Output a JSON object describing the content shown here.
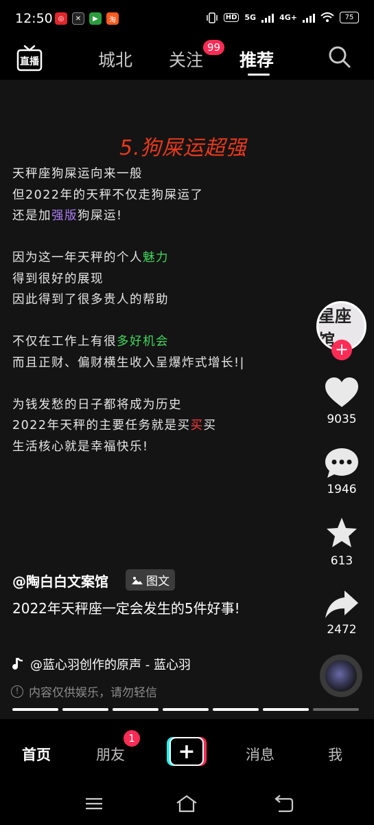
{
  "status_bar": {
    "time": "12:50",
    "network": "5G",
    "network2": "4G+",
    "battery": "75",
    "hd_label": "HD"
  },
  "top_nav": {
    "tabs": [
      {
        "label": "城北",
        "active": false
      },
      {
        "label": "关注",
        "active": false
      },
      {
        "label": "推荐",
        "active": true
      }
    ],
    "follow_badge": "99",
    "live_label": "直播"
  },
  "post": {
    "headline": "5.狗屎运超强",
    "lines": [
      [
        {
          "t": "天秤座狗屎运向来一般"
        }
      ],
      [
        {
          "t": "但2022年的天秤不仅走狗屎运了"
        }
      ],
      [
        {
          "t": "还是加"
        },
        {
          "t": "强版",
          "c": "purple"
        },
        {
          "t": "狗屎运!"
        }
      ],
      [],
      [
        {
          "t": "因为这一年天秤的个人"
        },
        {
          "t": "魅力",
          "c": "green"
        }
      ],
      [
        {
          "t": "得到很好的展现"
        }
      ],
      [
        {
          "t": "因此得到了很多贵人的帮助"
        }
      ],
      [],
      [
        {
          "t": "不仅在工作上有很"
        },
        {
          "t": "多好机会",
          "c": "green"
        }
      ],
      [
        {
          "t": "而且正财、偏财横生收入呈爆炸式增长!|"
        }
      ],
      [],
      [
        {
          "t": "为钱发愁的日子都将成为历史"
        }
      ],
      [
        {
          "t": "2022年天秤的主要任务就是买"
        },
        {
          "t": "买",
          "c": "red"
        },
        {
          "t": "买"
        }
      ],
      [
        {
          "t": "生活核心就是幸福快乐!"
        }
      ]
    ],
    "avatar_text": "星座馆",
    "likes": "9035",
    "comments": "1946",
    "favorites": "613",
    "shares": "2472",
    "author": "@陶白白文案馆",
    "type_tag": "图文",
    "caption": "2022年天秤座一定会发生的5件好事!",
    "music": "@蓝心羽创作的原声 - 蓝心羽",
    "disclaimer": "内容仅供娱乐，请勿轻信",
    "progress": {
      "total": 7,
      "current": 6
    }
  },
  "bottom_nav": {
    "tabs": [
      "首页",
      "朋友",
      "消息",
      "我"
    ],
    "friends_badge": "1"
  },
  "colors": {
    "accent": "#fe2c55",
    "cyan": "#25f4ee",
    "headline": "#e8381b"
  }
}
